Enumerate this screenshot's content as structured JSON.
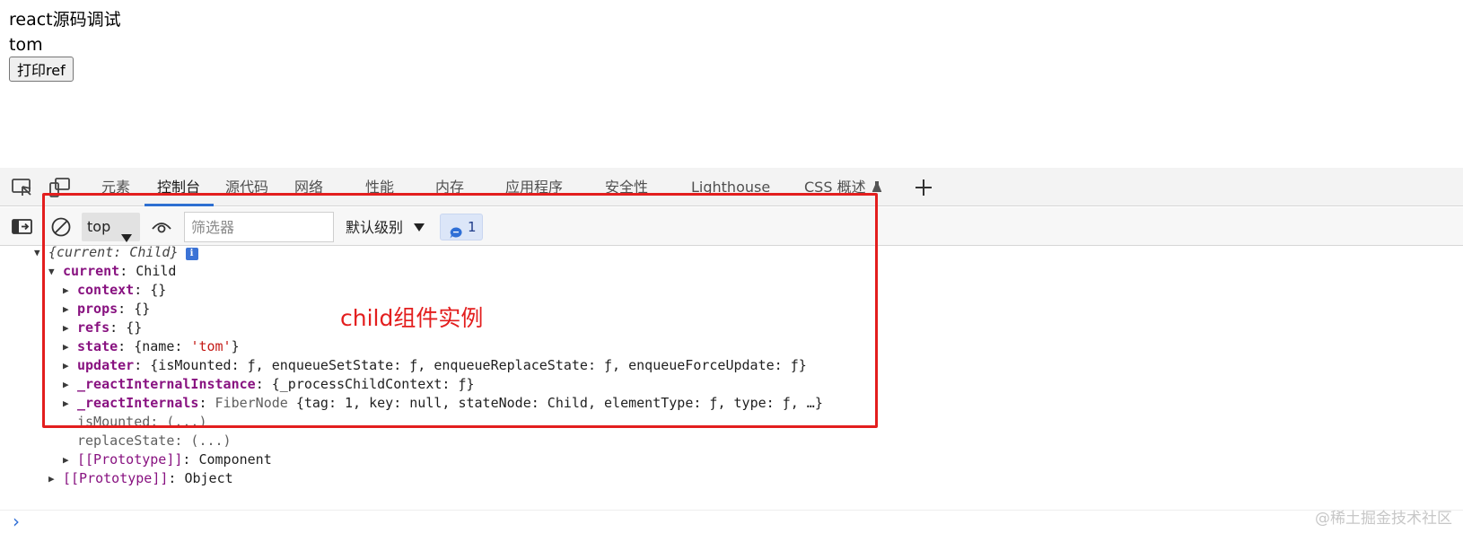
{
  "page": {
    "heading": "react源码调试",
    "name": "tom",
    "print_button_label": "打印ref"
  },
  "devtools": {
    "tabs": [
      {
        "label": "元素",
        "active": false
      },
      {
        "label": "控制台",
        "active": true
      },
      {
        "label": "源代码",
        "active": false
      },
      {
        "label": "网络",
        "active": false
      },
      {
        "label": "性能",
        "active": false
      },
      {
        "label": "内存",
        "active": false
      },
      {
        "label": "应用程序",
        "active": false
      },
      {
        "label": "安全性",
        "active": false
      },
      {
        "label": "Lighthouse",
        "active": false
      },
      {
        "label": "CSS 概述",
        "active": false
      }
    ],
    "toolbar_icons": [
      "inspect-element-icon",
      "device-toolbar-icon",
      "add-tab-icon",
      "flask-icon"
    ],
    "accent_color": "#2e6fd1"
  },
  "console_toolbar": {
    "icons": [
      "sidebar-toggle-icon",
      "clear-console-icon",
      "eye-icon",
      "message-icon"
    ],
    "context": "top",
    "filter_placeholder": "筛选器",
    "level": "默认级别",
    "message_count": "1"
  },
  "console": {
    "summary": "{current: Child}",
    "info_badge": "i",
    "current_key": "current",
    "current_value": "Child",
    "props": [
      {
        "key": "context",
        "value": "{}"
      },
      {
        "key": "props",
        "value": "{}"
      },
      {
        "key": "refs",
        "value": "{}"
      },
      {
        "key": "state",
        "prefix": "{name: ",
        "str": "'tom'",
        "suffix": "}"
      },
      {
        "key": "updater",
        "value": "{isMounted: ƒ, enqueueSetState: ƒ, enqueueReplaceState: ƒ, enqueueForceUpdate: ƒ}"
      },
      {
        "key": "_reactInternalInstance",
        "value": "{_processChildContext: ƒ}"
      },
      {
        "key": "_reactInternals",
        "type": "FiberNode",
        "value": "{tag: 1, key: null, stateNode: Child, elementType: ƒ, type: ƒ, …}"
      }
    ],
    "getter_1": "isMounted: (...)",
    "getter_2": "replaceState: (...)",
    "proto_inner_key": "[[Prototype]]",
    "proto_inner_value": "Component",
    "proto_outer_key": "[[Prototype]]",
    "proto_outer_value": "Object",
    "prompt": "›"
  },
  "annotation": {
    "text": "child组件实例",
    "color": "#e31e1e"
  },
  "watermark": "@稀土掘金技术社区"
}
